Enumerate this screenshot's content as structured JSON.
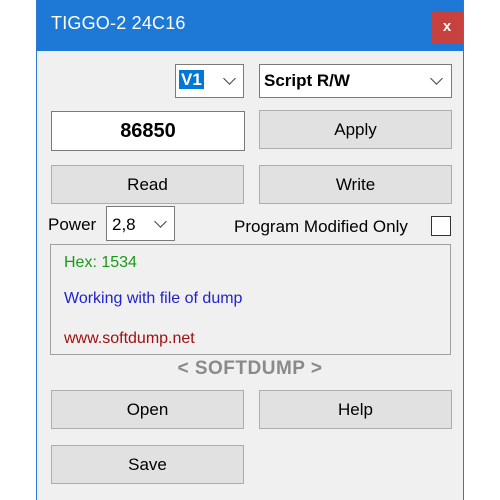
{
  "window": {
    "title": "TIGGO-2 24C16",
    "close_label": "x"
  },
  "version_select": {
    "value": "V1"
  },
  "mode_select": {
    "value": "Script R/W"
  },
  "value_field": {
    "value": "86850"
  },
  "buttons": {
    "apply": "Apply",
    "read": "Read",
    "write": "Write",
    "open": "Open",
    "help": "Help",
    "save": "Save"
  },
  "power": {
    "label": "Power",
    "value": "2,8"
  },
  "program_modified": {
    "label": "Program Modified Only",
    "checked": false
  },
  "info": {
    "hex": "Hex: 1534",
    "status": "Working with file of dump",
    "website": "www.softdump.net"
  },
  "brand": "< SOFTDUMP >",
  "colors": {
    "titlebar": "#1e79d6",
    "close": "#c7413f",
    "hex_text": "#1a9a1a",
    "status_text": "#2222cc",
    "website_text": "#a01010",
    "brand_text": "#8a8a8a"
  }
}
